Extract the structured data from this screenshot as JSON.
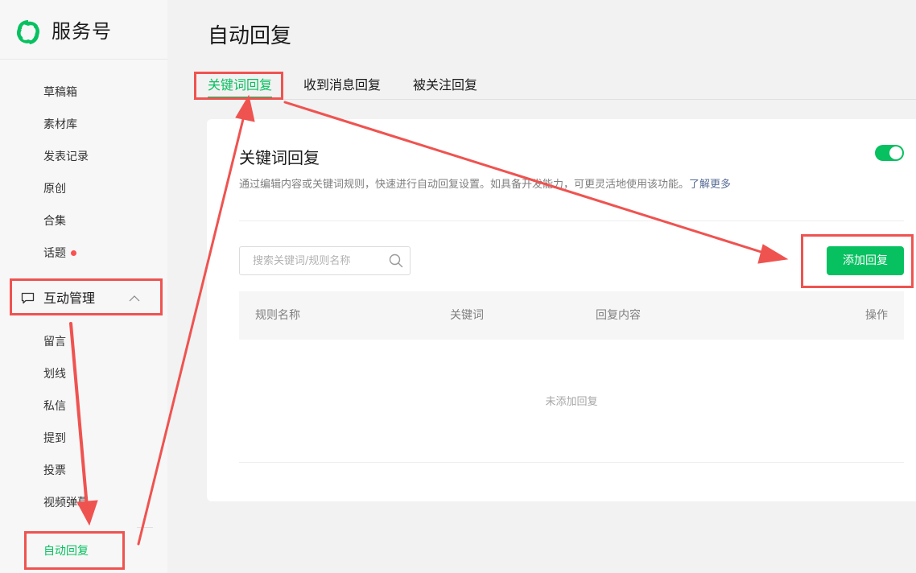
{
  "brand": {
    "name": "服务号"
  },
  "sidebar": {
    "items": [
      {
        "label": "草稿箱"
      },
      {
        "label": "素材库"
      },
      {
        "label": "发表记录"
      },
      {
        "label": "原创"
      },
      {
        "label": "合集"
      },
      {
        "label": "话题",
        "dot": true
      }
    ],
    "group": {
      "label": "互动管理",
      "expanded": true
    },
    "sub_items": [
      {
        "label": "留言"
      },
      {
        "label": "划线"
      },
      {
        "label": "私信"
      },
      {
        "label": "提到"
      },
      {
        "label": "投票"
      },
      {
        "label": "视频弹幕"
      },
      {
        "label": "自动回复",
        "active": true
      }
    ]
  },
  "main": {
    "title": "自动回复",
    "tabs": [
      {
        "label": "关键词回复",
        "active": true
      },
      {
        "label": "收到消息回复"
      },
      {
        "label": "被关注回复"
      }
    ],
    "card": {
      "title": "关键词回复",
      "description": "通过编辑内容或关键词规则，快速进行自动回复设置。如具备开发能力，可更灵活地使用该功能。",
      "link": "了解更多",
      "toggle_on": true,
      "search": {
        "placeholder": "搜索关键词/规则名称",
        "value": ""
      },
      "add_button": "添加回复",
      "table": {
        "columns": [
          "规则名称",
          "关键词",
          "回复内容",
          "操作"
        ],
        "rows": [],
        "empty_text": "未添加回复"
      }
    }
  },
  "colors": {
    "accent": "#07c160",
    "annotation": "#ef5350",
    "link": "#576b95",
    "dot": "#fa5151"
  }
}
